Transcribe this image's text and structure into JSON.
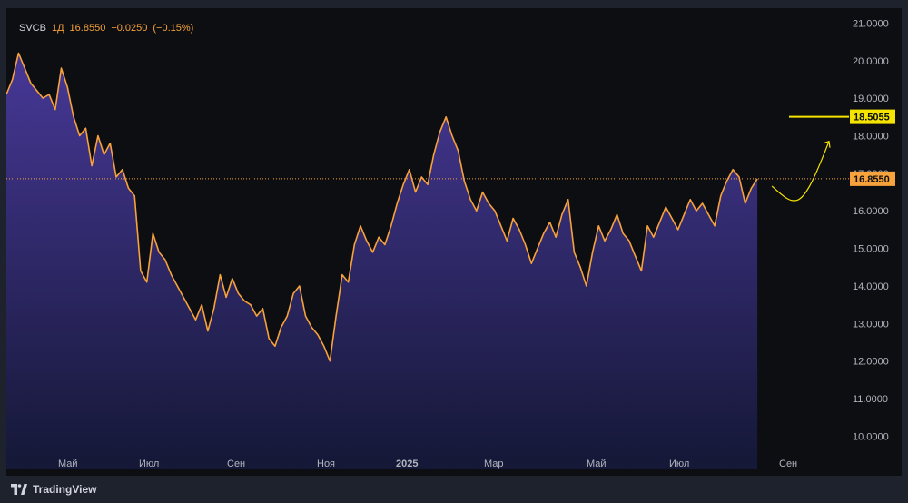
{
  "header": {
    "symbol": "SVCB",
    "interval": "1Д",
    "last": "16.8550",
    "change": "−0.0250",
    "change_pct": "(−0.15%)"
  },
  "brand": {
    "name": "TradingView"
  },
  "colors": {
    "line": "#f7a23a",
    "fill_top": "#4a3a9e",
    "fill_bottom": "#151838",
    "target_line": "#f5e400",
    "background": "#0d0e12",
    "axis_text": "#b2b5be"
  },
  "chart_data": {
    "type": "area",
    "title": "",
    "xlabel": "",
    "ylabel": "",
    "ylim": [
      9.6,
      21.3
    ],
    "y_ticks": [
      "10.0000",
      "11.0000",
      "12.0000",
      "13.0000",
      "14.0000",
      "15.0000",
      "16.0000",
      "17.0000",
      "18.0000",
      "19.0000",
      "20.0000",
      "21.0000"
    ],
    "x_ticks": [
      "Май",
      "Июл",
      "Сен",
      "Ноя",
      "2025",
      "Мар",
      "Май",
      "Июл",
      "Сен"
    ],
    "x_range": [
      "2024-04-01",
      "2025-10-05"
    ],
    "series": [
      {
        "values": [
          [
            "2024-04-01",
            19.1
          ],
          [
            "2024-04-05",
            19.5
          ],
          [
            "2024-04-09",
            20.2
          ],
          [
            "2024-04-13",
            19.8
          ],
          [
            "2024-04-17",
            19.4
          ],
          [
            "2024-04-21",
            19.2
          ],
          [
            "2024-04-25",
            19.0
          ],
          [
            "2024-04-29",
            19.1
          ],
          [
            "2024-05-03",
            18.7
          ],
          [
            "2024-05-07",
            19.8
          ],
          [
            "2024-05-11",
            19.3
          ],
          [
            "2024-05-15",
            18.5
          ],
          [
            "2024-05-19",
            18.0
          ],
          [
            "2024-05-23",
            18.2
          ],
          [
            "2024-05-27",
            17.2
          ],
          [
            "2024-05-31",
            18.0
          ],
          [
            "2024-06-04",
            17.5
          ],
          [
            "2024-06-08",
            17.8
          ],
          [
            "2024-06-12",
            16.9
          ],
          [
            "2024-06-16",
            17.1
          ],
          [
            "2024-06-20",
            16.6
          ],
          [
            "2024-06-24",
            16.4
          ],
          [
            "2024-06-28",
            14.4
          ],
          [
            "2024-07-02",
            14.1
          ],
          [
            "2024-07-06",
            15.4
          ],
          [
            "2024-07-10",
            14.9
          ],
          [
            "2024-07-14",
            14.7
          ],
          [
            "2024-07-18",
            14.3
          ],
          [
            "2024-07-22",
            14.0
          ],
          [
            "2024-07-26",
            13.7
          ],
          [
            "2024-07-30",
            13.4
          ],
          [
            "2024-08-03",
            13.1
          ],
          [
            "2024-08-07",
            13.5
          ],
          [
            "2024-08-11",
            12.8
          ],
          [
            "2024-08-15",
            13.4
          ],
          [
            "2024-08-19",
            14.3
          ],
          [
            "2024-08-23",
            13.7
          ],
          [
            "2024-08-27",
            14.2
          ],
          [
            "2024-08-31",
            13.8
          ],
          [
            "2024-09-04",
            13.6
          ],
          [
            "2024-09-08",
            13.5
          ],
          [
            "2024-09-12",
            13.2
          ],
          [
            "2024-09-16",
            13.4
          ],
          [
            "2024-09-20",
            12.6
          ],
          [
            "2024-09-24",
            12.4
          ],
          [
            "2024-09-28",
            12.9
          ],
          [
            "2024-10-02",
            13.2
          ],
          [
            "2024-10-06",
            13.8
          ],
          [
            "2024-10-10",
            14.0
          ],
          [
            "2024-10-14",
            13.2
          ],
          [
            "2024-10-18",
            12.9
          ],
          [
            "2024-10-22",
            12.7
          ],
          [
            "2024-10-26",
            12.4
          ],
          [
            "2024-10-30",
            12.0
          ],
          [
            "2024-11-03",
            13.2
          ],
          [
            "2024-11-07",
            14.3
          ],
          [
            "2024-11-11",
            14.1
          ],
          [
            "2024-11-15",
            15.1
          ],
          [
            "2024-11-19",
            15.6
          ],
          [
            "2024-11-23",
            15.2
          ],
          [
            "2024-11-27",
            14.9
          ],
          [
            "2024-12-01",
            15.3
          ],
          [
            "2024-12-05",
            15.1
          ],
          [
            "2024-12-09",
            15.6
          ],
          [
            "2024-12-13",
            16.2
          ],
          [
            "2024-12-17",
            16.7
          ],
          [
            "2024-12-21",
            17.1
          ],
          [
            "2024-12-25",
            16.5
          ],
          [
            "2024-12-29",
            16.9
          ],
          [
            "2025-01-02",
            16.7
          ],
          [
            "2025-01-06",
            17.5
          ],
          [
            "2025-01-10",
            18.1
          ],
          [
            "2025-01-14",
            18.5
          ],
          [
            "2025-01-18",
            18.0
          ],
          [
            "2025-01-22",
            17.6
          ],
          [
            "2025-01-26",
            16.8
          ],
          [
            "2025-01-30",
            16.3
          ],
          [
            "2025-02-03",
            16.0
          ],
          [
            "2025-02-07",
            16.5
          ],
          [
            "2025-02-11",
            16.2
          ],
          [
            "2025-02-15",
            16.0
          ],
          [
            "2025-02-19",
            15.6
          ],
          [
            "2025-02-23",
            15.2
          ],
          [
            "2025-02-27",
            15.8
          ],
          [
            "2025-03-03",
            15.5
          ],
          [
            "2025-03-07",
            15.1
          ],
          [
            "2025-03-11",
            14.6
          ],
          [
            "2025-03-15",
            15.0
          ],
          [
            "2025-03-19",
            15.4
          ],
          [
            "2025-03-23",
            15.7
          ],
          [
            "2025-03-27",
            15.3
          ],
          [
            "2025-03-31",
            15.9
          ],
          [
            "2025-04-04",
            16.3
          ],
          [
            "2025-04-08",
            14.9
          ],
          [
            "2025-04-12",
            14.5
          ],
          [
            "2025-04-16",
            14.0
          ],
          [
            "2025-04-20",
            14.9
          ],
          [
            "2025-04-24",
            15.6
          ],
          [
            "2025-04-28",
            15.2
          ],
          [
            "2025-05-02",
            15.5
          ],
          [
            "2025-05-06",
            15.9
          ],
          [
            "2025-05-10",
            15.4
          ],
          [
            "2025-05-14",
            15.2
          ],
          [
            "2025-05-18",
            14.8
          ],
          [
            "2025-05-22",
            14.4
          ],
          [
            "2025-05-26",
            15.6
          ],
          [
            "2025-05-30",
            15.3
          ],
          [
            "2025-06-03",
            15.7
          ],
          [
            "2025-06-07",
            16.1
          ],
          [
            "2025-06-11",
            15.8
          ],
          [
            "2025-06-15",
            15.5
          ],
          [
            "2025-06-19",
            15.9
          ],
          [
            "2025-06-23",
            16.3
          ],
          [
            "2025-06-27",
            16.0
          ],
          [
            "2025-07-01",
            16.2
          ],
          [
            "2025-07-05",
            15.9
          ],
          [
            "2025-07-09",
            15.6
          ],
          [
            "2025-07-13",
            16.4
          ],
          [
            "2025-07-17",
            16.8
          ],
          [
            "2025-07-21",
            17.1
          ],
          [
            "2025-07-25",
            16.9
          ],
          [
            "2025-07-29",
            16.2
          ],
          [
            "2025-08-02",
            16.6
          ],
          [
            "2025-08-06",
            16.855
          ]
        ]
      }
    ],
    "last_price_label": "16.8550",
    "target_label": "18.5055",
    "target_value": 18.5055
  }
}
